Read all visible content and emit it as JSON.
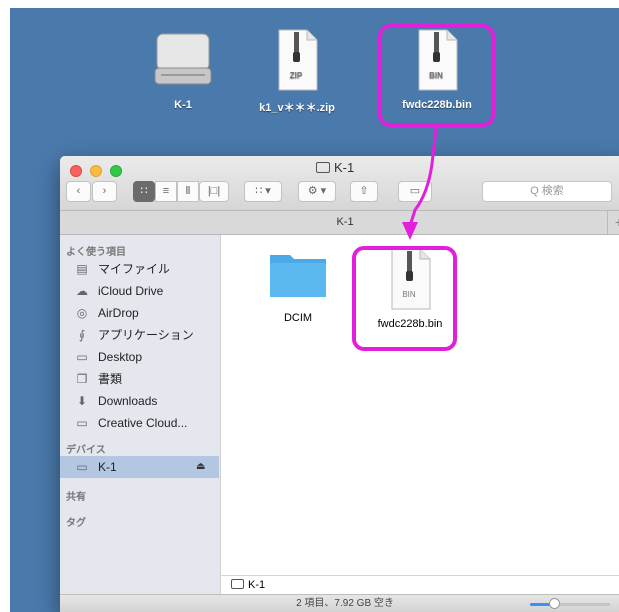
{
  "desktop": {
    "icons": [
      {
        "label": "K-1",
        "kind": "drive"
      },
      {
        "label": "k1_v＊＊＊.zip",
        "doc_tag": "ZIP"
      },
      {
        "label": "fwdc228b.bin",
        "doc_tag": "BIN"
      }
    ]
  },
  "colors": {
    "highlight": "#e21fdb",
    "desktop": "#4a7aac",
    "sidebar_selected": "#b4c7e2",
    "folder": "#5bb9f0"
  },
  "window": {
    "title": "K-1",
    "tab_label": "K-1",
    "search_placeholder": "Q 検索",
    "toolbar_icons": [
      "back-chevron-icon",
      "forward-chevron-icon",
      "icon-view-icon",
      "list-view-icon",
      "column-view-icon",
      "coverflow-view-icon",
      "arrange-icon",
      "gear-action-icon",
      "share-icon",
      "tag-icon"
    ]
  },
  "sidebar": {
    "favorites_heading": "よく使う項目",
    "favorites": [
      {
        "label": "マイファイル",
        "icon": "all-my-files-icon"
      },
      {
        "label": "iCloud Drive",
        "icon": "cloud-icon"
      },
      {
        "label": "AirDrop",
        "icon": "airdrop-icon"
      },
      {
        "label": "アプリケーション",
        "icon": "applications-icon"
      },
      {
        "label": "Desktop",
        "icon": "desktop-icon"
      },
      {
        "label": "書類",
        "icon": "documents-icon"
      },
      {
        "label": "Downloads",
        "icon": "download-icon"
      },
      {
        "label": "Creative Cloud...",
        "icon": "folder-icon"
      }
    ],
    "devices_heading": "デバイス",
    "devices": [
      {
        "label": "K-1",
        "icon": "drive-icon"
      }
    ],
    "shared_heading": "共有",
    "tags_heading": "タグ"
  },
  "content": {
    "items": [
      {
        "label": "DCIM",
        "kind": "folder"
      },
      {
        "label": "fwdc228b.bin",
        "doc_tag": "BIN"
      }
    ]
  },
  "pathbar": {
    "label": "K-1"
  },
  "status": {
    "text": "2 項目、7.92 GB 空き",
    "zoom_fraction": 0.3
  }
}
